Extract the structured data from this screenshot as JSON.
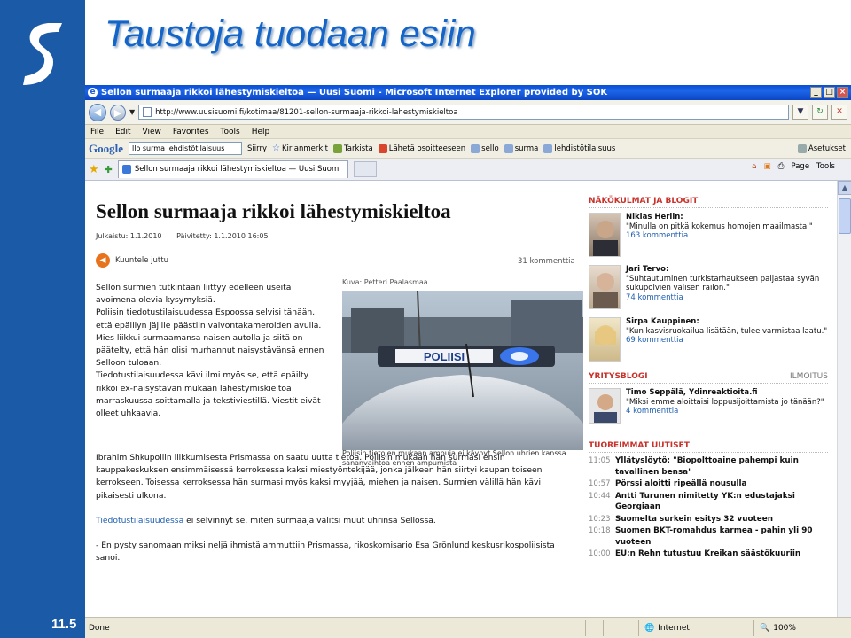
{
  "slide": {
    "title": "Taustoja tuodaan esiin",
    "number": "11.5"
  },
  "browser": {
    "window_title": "Sellon surmaaja rikkoi lähestymiskieltoa — Uusi Suomi - Microsoft Internet Explorer provided by SOK",
    "url": "http://www.uusisuomi.fi/kotimaa/81201-sellon-surmaaja-rikkoi-lahestymiskieltoa",
    "menu": [
      "File",
      "Edit",
      "View",
      "Favorites",
      "Tools",
      "Help"
    ],
    "google_toolbar": {
      "logo": "Google",
      "query": "llo surma lehdistötilaisuus",
      "items": [
        "Siirry",
        "Kirjanmerkit",
        "Tarkista",
        "Lähetä osoitteeseen",
        "sello",
        "surma",
        "lehdistötilaisuus",
        "Asetukset"
      ]
    },
    "tab_title": "Sellon surmaaja rikkoi lähestymiskieltoa — Uusi Suomi",
    "command_bar": [
      "Page",
      "Tools"
    ],
    "status_text": "Done",
    "zone": "Internet",
    "zoom": "100%"
  },
  "article": {
    "headline": "Sellon surmaaja rikkoi lähestymiskieltoa",
    "published_label": "Julkaistu: 1.1.2010",
    "updated_label": "Päivitetty: 1.1.2010 16:05",
    "listen_label": "Kuuntele juttu",
    "comment_count": "31 kommenttia",
    "photo_credit": "Kuva: Petteri Paalasmaa",
    "photo_caption": "Poliisin tietojen mukaan ampuja ei käynyt Sellon uhrien kanssa sananvaihtoa ennen ampumista",
    "photo_sign": "POLIISI",
    "para1": "Sellon surmien tutkintaan liittyy edelleen useita avoimena olevia kysymyksiä.",
    "para2": "Poliisin tiedotustilaisuudessa Espoossa selvisi tänään, että epäillyn jäjille päästiin valvontakameroiden avulla.",
    "para3": "Mies liikkui surmaamansa naisen autolla ja siitä on päätelty, että hän olisi murhannut naisystävänsä ennen Selloon tuloaan.",
    "para4": "Tiedotustilaisuudessa kävi ilmi myös se, että epäilty rikkoi ex-naisystävän mukaan lähestymiskieltoa marraskuussa soittamalla ja tekstiviestillä. Viestit eivät olleet uhkaavia.",
    "para5": "Ibrahim Shkupollin liikkumisesta Prismassa on saatu uutta tietoa. Poliisin mukaan hän surmasi ensin kauppakeskuksen ensimmäisessä kerroksessa kaksi miestyöntekijää, jonka jälkeen hän siirtyi kaupan toiseen kerrokseen. Toisessa kerroksessa hän surmasi myös kaksi myyjää, miehen ja naisen. Surmien välillä hän kävi pikaisesti ulkona.",
    "para6_link": "Tiedotustilaisuudessa",
    "para6_rest": " ei selvinnyt se, miten surmaaja valitsi muut uhrinsa Sellossa.",
    "para7": "- En pysty sanomaan miksi neljä ihmistä ammuttiin Prismassa, rikoskomisario Esa Grönlund keskusrikospoliisista sanoi."
  },
  "sidebar_news": {
    "blogs_heading": "NÄKÖKULMAT JA BLOGIT",
    "blogs": [
      {
        "name": "Niklas Herlin:",
        "quote": "\"Minulla on pitkä kokemus homojen maailmasta.\"",
        "count": "163 kommenttia"
      },
      {
        "name": "Jari Tervo:",
        "quote": "\"Suhtautuminen turkistarhaukseen paljastaa syvän sukupolvien välisen railon.\"",
        "count": "74 kommenttia"
      },
      {
        "name": "Sirpa Kauppinen:",
        "quote": "\"Kun kasvisruokailua lisätään, tulee varmistaa laatu.\"",
        "count": "69 kommenttia"
      }
    ],
    "company_heading": "YRITYSBLOGI",
    "ad_label": "ILMOITUS",
    "company": {
      "name": "Timo Seppälä, Ydinreaktioita.fi",
      "quote": "\"Miksi emme aloittaisi loppusijoittamista jo tänään?\"",
      "count": "4 kommenttia"
    },
    "news_heading": "TUOREIMMAT UUTISET",
    "news": [
      {
        "time": "11:05",
        "text": "Yllätyslöytö: \"Biopolttoaine pahempi kuin tavallinen bensa\""
      },
      {
        "time": "10:57",
        "text": "Pörssi aloitti ripeällä nousulla"
      },
      {
        "time": "10:44",
        "text": "Antti Turunen nimitetty YK:n edustajaksi Georgiaan"
      },
      {
        "time": "10:23",
        "text": "Suomelta surkein esitys 32 vuoteen"
      },
      {
        "time": "10:18",
        "text": "Suomen BKT-romahdus karmea - pahin yli 90 vuoteen"
      },
      {
        "time": "10:00",
        "text": "EU:n Rehn tutustuu Kreikan säästökuuriin"
      }
    ]
  },
  "colors": {
    "sidebar_blue": "#1a5aa6",
    "title_blue": "#1565c8",
    "section_red": "#c8322b",
    "link_blue": "#1f5fb0"
  }
}
